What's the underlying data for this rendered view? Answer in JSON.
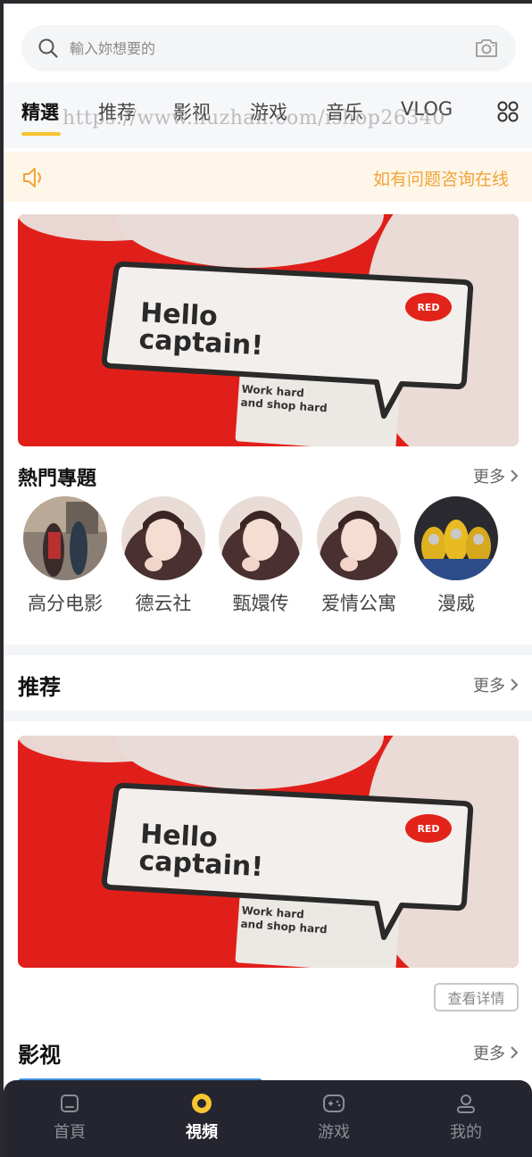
{
  "search": {
    "placeholder": "輸入妳想要的"
  },
  "tabs": [
    {
      "label": "精選"
    },
    {
      "label": "推荐"
    },
    {
      "label": "影视"
    },
    {
      "label": "游戏"
    },
    {
      "label": "音乐"
    },
    {
      "label": "VLOG"
    }
  ],
  "watermark": "https://www.huzhan.com/ishop26340",
  "notice": {
    "text": "如有问题咨询在线"
  },
  "banner": {
    "headline_1": "Hello",
    "headline_2": "captain!",
    "badge": "RED",
    "card_line_1": "Work hard",
    "card_line_2": "and shop hard"
  },
  "hot_topics": {
    "title": "熱門專題",
    "more": "更多",
    "items": [
      {
        "label": "高分电影"
      },
      {
        "label": "德云社"
      },
      {
        "label": "甄嬛传"
      },
      {
        "label": "爱情公寓"
      },
      {
        "label": "漫威"
      }
    ]
  },
  "recommend": {
    "title": "推荐",
    "more": "更多",
    "detail_button": "查看详情"
  },
  "video": {
    "title": "影视",
    "more": "更多"
  },
  "bottom_nav": [
    {
      "label": "首頁",
      "icon": "home-icon"
    },
    {
      "label": "視頻",
      "icon": "play-icon"
    },
    {
      "label": "游戏",
      "icon": "gamepad-icon"
    },
    {
      "label": "我的",
      "icon": "user-icon"
    }
  ],
  "colors": {
    "accent": "#f7c530",
    "notice": "#f2a33a",
    "nav_bg": "#252530"
  }
}
